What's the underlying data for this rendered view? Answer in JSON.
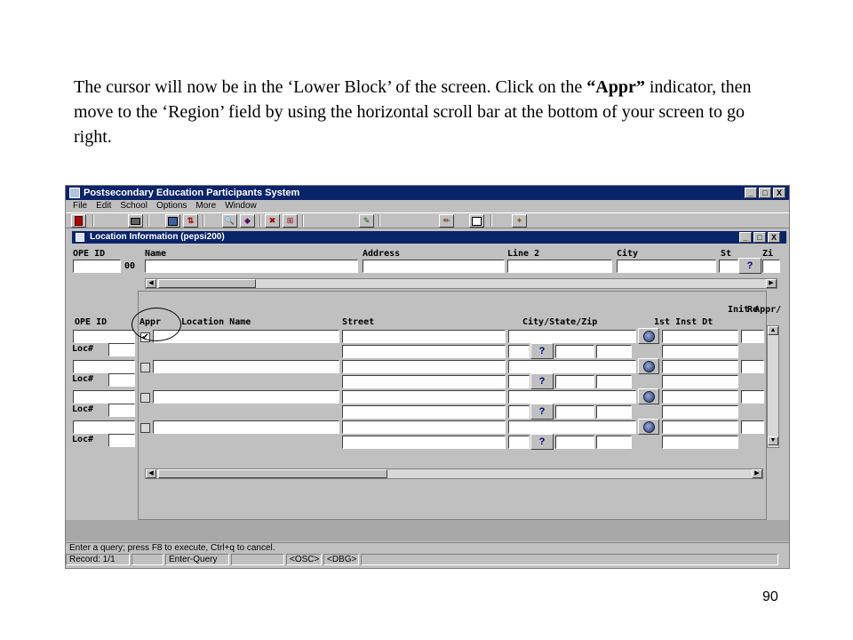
{
  "instruction": {
    "part1": "The cursor will now be in the ‘Lower Block’ of the screen.  Click on the ",
    "bold": "“Appr”",
    "part2": " indicator, then move to the ‘Region’ field by using the horizontal scroll bar at the bottom of your screen to go right."
  },
  "page_number": "90",
  "app": {
    "title": "Postsecondary Education Participants System",
    "menu": [
      "File",
      "Edit",
      "School",
      "Options",
      "More",
      "Window"
    ],
    "window_buttons": [
      "_",
      "□",
      "X"
    ]
  },
  "toolbar": {
    "icons": [
      "exit-icon",
      "print-icon",
      "save-icon",
      "sort-icon",
      "query-icon",
      "execute-icon",
      "delete-icon",
      "insert-icon",
      "clear-icon",
      "edit-icon",
      "list-icon",
      "help-icon"
    ]
  },
  "inner_window": {
    "title": "Location Information (pepsi200)"
  },
  "master_block": {
    "headers": {
      "ope_id": "OPE ID",
      "name": "Name",
      "address": "Address",
      "line2": "Line 2",
      "city": "City",
      "st": "St",
      "zip": "Zi"
    },
    "ope_suffix": "00",
    "lov_symbol": "?"
  },
  "detail_block": {
    "headers": {
      "ope_id": "OPE ID",
      "appr": "Appr",
      "location_name": "Location Name",
      "street": "Street",
      "city_state_zip": "City/State/Zip",
      "init_appr_line1": "Init Appr/",
      "init_appr_line2": "1st Inst Dt",
      "region": "Re"
    },
    "loc_label": "Loc#",
    "first_appr_checked": "✔",
    "row_count": 4
  },
  "status": {
    "message": "Enter a query;  press F8 to execute, Ctrl+q  to cancel.",
    "cells": [
      "Record: 1/1",
      "",
      "Enter-Query",
      "",
      "<OSC>",
      "<DBG>"
    ]
  },
  "colors": {
    "title_bar": "#0a246a",
    "window_bg": "#c0c0c0"
  }
}
